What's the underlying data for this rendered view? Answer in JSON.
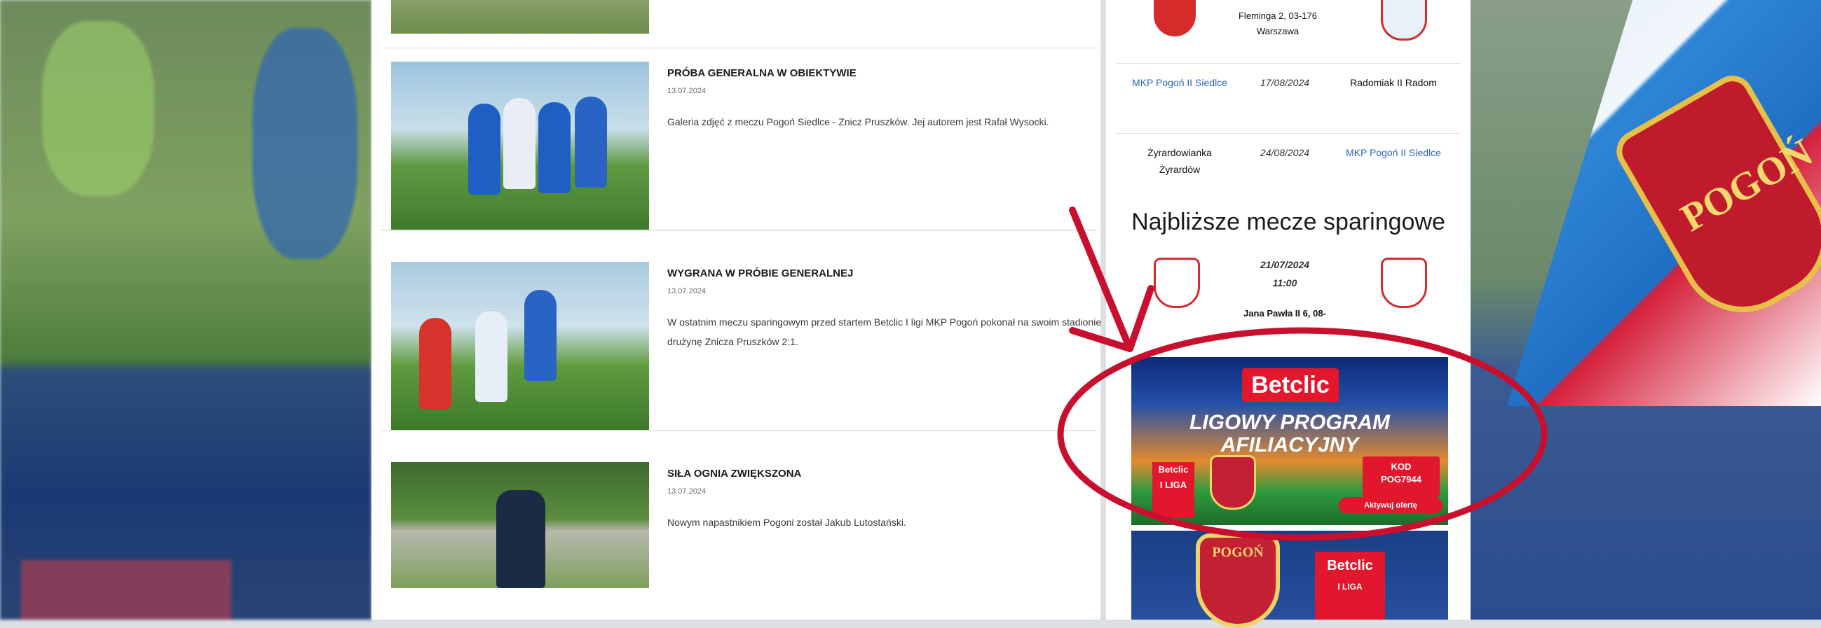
{
  "articles": [
    {
      "title": "PRÓBA GENERALNA W OBIEKTYWIE",
      "date": "13.07.2024",
      "excerpt": "Galeria zdjęć z meczu Pogoń Siedlce - Znicz Pruszków. Jej autorem jest Rafał Wysocki."
    },
    {
      "title": "WYGRANA W PRÓBIE GENERALNEJ",
      "date": "13.07.2024",
      "excerpt": "W ostatnim meczu sparingowym przed startem Betclic I ligi MKP Pogoń pokonał na swoim stadionie drużynę Znicza Pruszków 2:1."
    },
    {
      "title": "SIŁA OGNIA ZWIĘKSZONA",
      "date": "13.07.2024",
      "excerpt": "Nowym napastnikiem Pogoni został Jakub Lutostański."
    }
  ],
  "fixtures": {
    "top_address": "Fleminga 2, 03-176 Warszawa",
    "rows": [
      {
        "home": "MKP Pogoń II Siedlce",
        "date": "17/08/2024",
        "away": "Radomiak II Radom"
      },
      {
        "home": "Żyrardowianka Żyrardów",
        "date": "24/08/2024",
        "away": "MKP Pogoń II Siedlce"
      }
    ]
  },
  "sparring": {
    "heading": "Najbliższe mecze sparingowe",
    "date": "21/07/2024",
    "time": "11:00",
    "address": "Jana Pawła II 6, 08-"
  },
  "banner": {
    "brand": "Betclic",
    "headline_1": "LIGOWY PROGRAM",
    "headline_2": "AFILIACYJNY",
    "code_label": "KOD",
    "code": "POG7944",
    "button": "Aktywuj ofertę",
    "small_logo": "Betclic",
    "small_league": "I LIGA"
  },
  "banner2": {
    "crest_text": "POGOŃ",
    "brand": "Betclic",
    "league": "I LIGA"
  },
  "colors": {
    "link_blue": "#2a66c0",
    "annotation_red": "#c8102e",
    "betclic_red": "#e2162c"
  }
}
